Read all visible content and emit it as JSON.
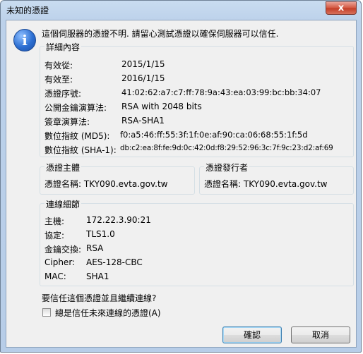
{
  "window": {
    "title": "未知的憑證",
    "close_glyph": "x"
  },
  "message": "這個伺服器的憑證不明. 請留心測試憑證以確保伺服器可以信任.",
  "details": {
    "title": "詳細內容",
    "rows": [
      {
        "label": "有效從:",
        "value": "2015/1/15"
      },
      {
        "label": "有效至:",
        "value": "2016/1/15"
      },
      {
        "label": "憑證序號:",
        "value": "41:02:62:a7:c7:ff:78:9a:43:ea:03:99:bc:bb:34:07"
      },
      {
        "label": "公開金鑰演算法:",
        "value": "RSA with 2048 bits"
      },
      {
        "label": "簽章演算法:",
        "value": "RSA-SHA1"
      },
      {
        "label": "數位指紋 (MD5):",
        "value": "f0:a5:46:ff:55:3f:1f:0e:af:90:ca:06:68:55:1f:5d"
      },
      {
        "label": "數位指紋 (SHA-1):",
        "value": "db:c2:ea:8f:fe:9d:0c:42:0d:f8:29:52:96:3c:7f:9c:23:d2:af:69"
      }
    ]
  },
  "subject": {
    "title": "憑證主體",
    "line": "憑證名稱: TKY090.evta.gov.tw"
  },
  "issuer": {
    "title": "憑證發行者",
    "line": "憑證名稱: TKY090.evta.gov.tw"
  },
  "connection": {
    "title": "連線細節",
    "rows": [
      {
        "label": "主機:",
        "value": "172.22.3.90:21"
      },
      {
        "label": "協定:",
        "value": "TLS1.0"
      },
      {
        "label": "金鑰交換:",
        "value": "RSA"
      },
      {
        "label": "Cipher:",
        "value": "AES-128-CBC"
      },
      {
        "label": "MAC:",
        "value": "SHA1"
      }
    ]
  },
  "question": "要信任這個憑證並且繼續連線?",
  "always_trust": {
    "label": "總是信任未來連線的憑證(A)",
    "checked": false
  },
  "buttons": {
    "ok": "確認",
    "cancel": "取消"
  },
  "colors": {
    "title_bar": "#bcd1ea",
    "close_button": "#c23c26",
    "client_bg": "#f0f0f0",
    "info_icon": "#2d6fd2"
  }
}
